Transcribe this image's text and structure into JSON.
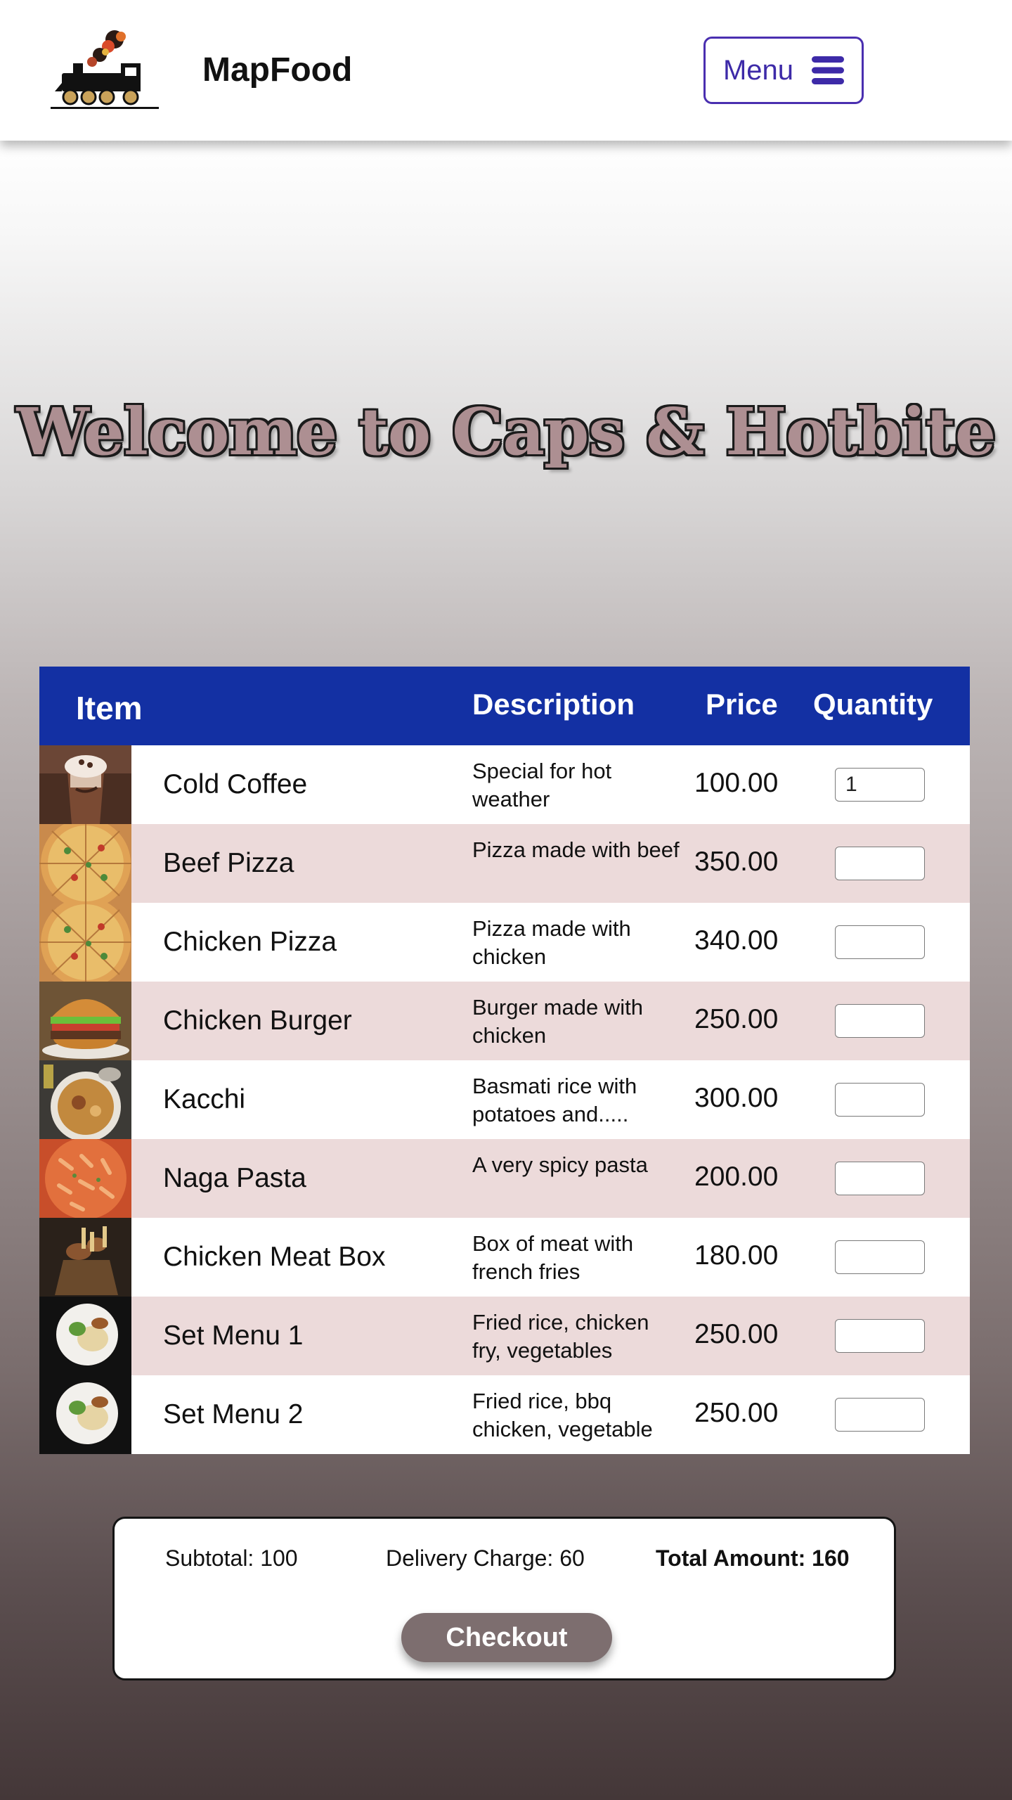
{
  "header": {
    "logo_text": "MAP FOOD",
    "brand": "MapFood",
    "menu_label": "Menu"
  },
  "hero": {
    "title": "Welcome to Caps & Hotbite"
  },
  "table": {
    "headers": {
      "item": "Item",
      "description": "Description",
      "price": "Price",
      "quantity": "Quantity"
    },
    "rows": [
      {
        "name": "Cold Coffee",
        "description": "Special for hot weather",
        "price": "100.00",
        "quantity": "1",
        "image_icon": "cold-coffee-image"
      },
      {
        "name": "Beef Pizza",
        "description": "Pizza made with beef",
        "price": "350.00",
        "quantity": "",
        "image_icon": "pizza-image"
      },
      {
        "name": "Chicken Pizza",
        "description": "Pizza made with chicken",
        "price": "340.00",
        "quantity": "",
        "image_icon": "pizza-image"
      },
      {
        "name": "Chicken Burger",
        "description": "Burger made with chicken",
        "price": "250.00",
        "quantity": "",
        "image_icon": "burger-image"
      },
      {
        "name": "Kacchi",
        "description": "Basmati rice with potatoes and.....",
        "price": "300.00",
        "quantity": "",
        "image_icon": "kacchi-image"
      },
      {
        "name": "Naga Pasta",
        "description": "A very spicy pasta",
        "price": "200.00",
        "quantity": "",
        "image_icon": "pasta-image"
      },
      {
        "name": "Chicken Meat Box",
        "description": "Box of meat with french fries",
        "price": "180.00",
        "quantity": "",
        "image_icon": "meat-box-image"
      },
      {
        "name": "Set Menu 1",
        "description": "Fried rice, chicken fry, vegetables",
        "price": "250.00",
        "quantity": "",
        "image_icon": "set-menu-plate-image"
      },
      {
        "name": "Set Menu 2",
        "description": "Fried rice, bbq chicken, vegetable",
        "price": "250.00",
        "quantity": "",
        "image_icon": "set-menu-plate-image"
      }
    ]
  },
  "summary": {
    "subtotal": "Subtotal: 100",
    "delivery": "Delivery Charge: 60",
    "total": "Total Amount: 160",
    "checkout_label": "Checkout"
  },
  "colors": {
    "header_bg": "#1330a3",
    "row_alt": "#ecdada",
    "menu_accent": "#4a2fb0",
    "title_fill": "#ad8f92",
    "checkout_bg": "#7d6e6f"
  }
}
